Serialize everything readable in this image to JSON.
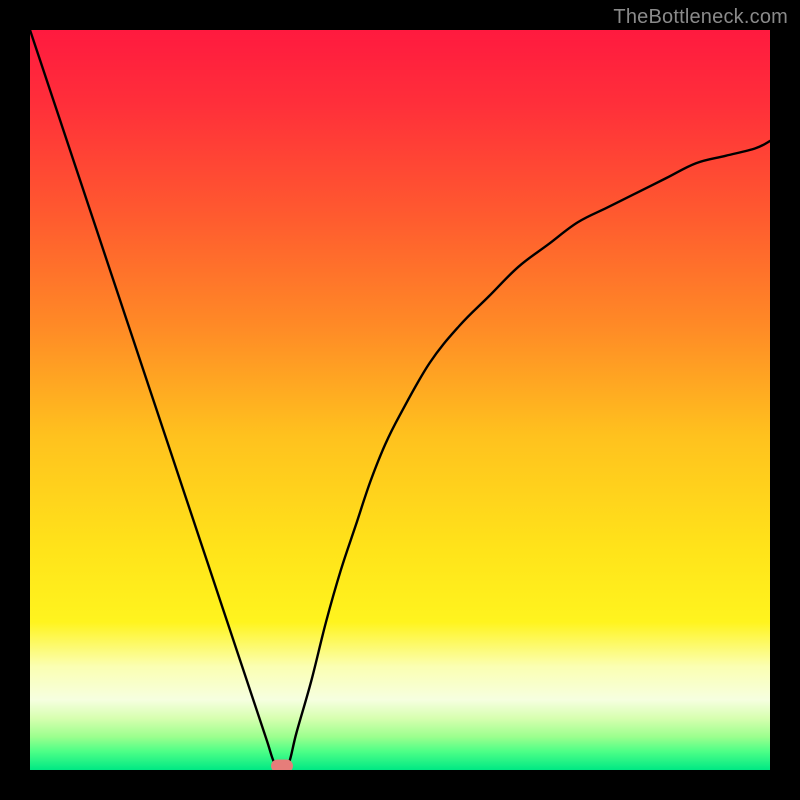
{
  "watermark": "TheBottleneck.com",
  "colors": {
    "frame": "#000000",
    "curve": "#000000",
    "marker": "#e67d7a",
    "gradient_stops": [
      {
        "offset": 0.0,
        "color": "#ff1a3f"
      },
      {
        "offset": 0.1,
        "color": "#ff2f3a"
      },
      {
        "offset": 0.25,
        "color": "#ff5a2f"
      },
      {
        "offset": 0.4,
        "color": "#ff8a26"
      },
      {
        "offset": 0.55,
        "color": "#ffc21e"
      },
      {
        "offset": 0.7,
        "color": "#ffe31a"
      },
      {
        "offset": 0.8,
        "color": "#fff41e"
      },
      {
        "offset": 0.86,
        "color": "#fbffb2"
      },
      {
        "offset": 0.905,
        "color": "#f6ffe0"
      },
      {
        "offset": 0.93,
        "color": "#d7ffb0"
      },
      {
        "offset": 0.955,
        "color": "#9cff8e"
      },
      {
        "offset": 0.975,
        "color": "#4dff87"
      },
      {
        "offset": 1.0,
        "color": "#00e884"
      }
    ]
  },
  "chart_data": {
    "type": "line",
    "title": "",
    "xlabel": "",
    "ylabel": "",
    "xlim": [
      0,
      100
    ],
    "ylim": [
      0,
      100
    ],
    "grid": false,
    "legend": false,
    "series": [
      {
        "name": "bottleneck-curve",
        "x": [
          0,
          2,
          4,
          6,
          8,
          10,
          12,
          14,
          16,
          18,
          20,
          22,
          24,
          26,
          28,
          30,
          32,
          33,
          34,
          35,
          36,
          38,
          40,
          42,
          44,
          46,
          48,
          50,
          54,
          58,
          62,
          66,
          70,
          74,
          78,
          82,
          86,
          90,
          94,
          98,
          100
        ],
        "y": [
          100,
          94,
          88,
          82,
          76,
          70,
          64,
          58,
          52,
          46,
          40,
          34,
          28,
          22,
          16,
          10,
          4,
          1,
          0,
          1,
          5,
          12,
          20,
          27,
          33,
          39,
          44,
          48,
          55,
          60,
          64,
          68,
          71,
          74,
          76,
          78,
          80,
          82,
          83,
          84,
          85
        ]
      }
    ],
    "annotations": [
      {
        "name": "optimal-point",
        "x": 34,
        "y": 0
      }
    ]
  }
}
